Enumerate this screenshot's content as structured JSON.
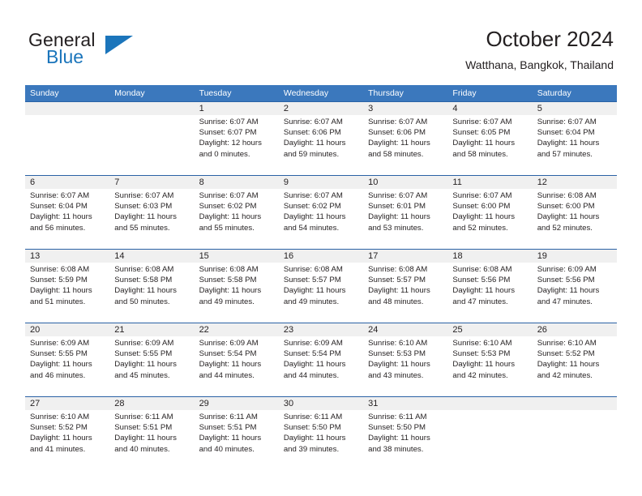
{
  "brand": {
    "name_top": "General",
    "name_bottom": "Blue",
    "logo_icon": "triangle-icon",
    "color_blue": "#1b75bb",
    "color_dark": "#231f20"
  },
  "header": {
    "title": "October 2024",
    "subtitle": "Watthana, Bangkok, Thailand"
  },
  "theme": {
    "header_band": "#3b78bd",
    "week_rule": "#2a62a5",
    "date_strip": "#f0f0f0",
    "text": "#231f20"
  },
  "weekdays": [
    "Sunday",
    "Monday",
    "Tuesday",
    "Wednesday",
    "Thursday",
    "Friday",
    "Saturday"
  ],
  "weeks": [
    {
      "days": [
        {
          "num": "",
          "sunrise": "",
          "sunset": "",
          "daylight1": "",
          "daylight2": ""
        },
        {
          "num": "",
          "sunrise": "",
          "sunset": "",
          "daylight1": "",
          "daylight2": ""
        },
        {
          "num": "1",
          "sunrise": "Sunrise: 6:07 AM",
          "sunset": "Sunset: 6:07 PM",
          "daylight1": "Daylight: 12 hours",
          "daylight2": "and 0 minutes."
        },
        {
          "num": "2",
          "sunrise": "Sunrise: 6:07 AM",
          "sunset": "Sunset: 6:06 PM",
          "daylight1": "Daylight: 11 hours",
          "daylight2": "and 59 minutes."
        },
        {
          "num": "3",
          "sunrise": "Sunrise: 6:07 AM",
          "sunset": "Sunset: 6:06 PM",
          "daylight1": "Daylight: 11 hours",
          "daylight2": "and 58 minutes."
        },
        {
          "num": "4",
          "sunrise": "Sunrise: 6:07 AM",
          "sunset": "Sunset: 6:05 PM",
          "daylight1": "Daylight: 11 hours",
          "daylight2": "and 58 minutes."
        },
        {
          "num": "5",
          "sunrise": "Sunrise: 6:07 AM",
          "sunset": "Sunset: 6:04 PM",
          "daylight1": "Daylight: 11 hours",
          "daylight2": "and 57 minutes."
        }
      ]
    },
    {
      "days": [
        {
          "num": "6",
          "sunrise": "Sunrise: 6:07 AM",
          "sunset": "Sunset: 6:04 PM",
          "daylight1": "Daylight: 11 hours",
          "daylight2": "and 56 minutes."
        },
        {
          "num": "7",
          "sunrise": "Sunrise: 6:07 AM",
          "sunset": "Sunset: 6:03 PM",
          "daylight1": "Daylight: 11 hours",
          "daylight2": "and 55 minutes."
        },
        {
          "num": "8",
          "sunrise": "Sunrise: 6:07 AM",
          "sunset": "Sunset: 6:02 PM",
          "daylight1": "Daylight: 11 hours",
          "daylight2": "and 55 minutes."
        },
        {
          "num": "9",
          "sunrise": "Sunrise: 6:07 AM",
          "sunset": "Sunset: 6:02 PM",
          "daylight1": "Daylight: 11 hours",
          "daylight2": "and 54 minutes."
        },
        {
          "num": "10",
          "sunrise": "Sunrise: 6:07 AM",
          "sunset": "Sunset: 6:01 PM",
          "daylight1": "Daylight: 11 hours",
          "daylight2": "and 53 minutes."
        },
        {
          "num": "11",
          "sunrise": "Sunrise: 6:07 AM",
          "sunset": "Sunset: 6:00 PM",
          "daylight1": "Daylight: 11 hours",
          "daylight2": "and 52 minutes."
        },
        {
          "num": "12",
          "sunrise": "Sunrise: 6:08 AM",
          "sunset": "Sunset: 6:00 PM",
          "daylight1": "Daylight: 11 hours",
          "daylight2": "and 52 minutes."
        }
      ]
    },
    {
      "days": [
        {
          "num": "13",
          "sunrise": "Sunrise: 6:08 AM",
          "sunset": "Sunset: 5:59 PM",
          "daylight1": "Daylight: 11 hours",
          "daylight2": "and 51 minutes."
        },
        {
          "num": "14",
          "sunrise": "Sunrise: 6:08 AM",
          "sunset": "Sunset: 5:58 PM",
          "daylight1": "Daylight: 11 hours",
          "daylight2": "and 50 minutes."
        },
        {
          "num": "15",
          "sunrise": "Sunrise: 6:08 AM",
          "sunset": "Sunset: 5:58 PM",
          "daylight1": "Daylight: 11 hours",
          "daylight2": "and 49 minutes."
        },
        {
          "num": "16",
          "sunrise": "Sunrise: 6:08 AM",
          "sunset": "Sunset: 5:57 PM",
          "daylight1": "Daylight: 11 hours",
          "daylight2": "and 49 minutes."
        },
        {
          "num": "17",
          "sunrise": "Sunrise: 6:08 AM",
          "sunset": "Sunset: 5:57 PM",
          "daylight1": "Daylight: 11 hours",
          "daylight2": "and 48 minutes."
        },
        {
          "num": "18",
          "sunrise": "Sunrise: 6:08 AM",
          "sunset": "Sunset: 5:56 PM",
          "daylight1": "Daylight: 11 hours",
          "daylight2": "and 47 minutes."
        },
        {
          "num": "19",
          "sunrise": "Sunrise: 6:09 AM",
          "sunset": "Sunset: 5:56 PM",
          "daylight1": "Daylight: 11 hours",
          "daylight2": "and 47 minutes."
        }
      ]
    },
    {
      "days": [
        {
          "num": "20",
          "sunrise": "Sunrise: 6:09 AM",
          "sunset": "Sunset: 5:55 PM",
          "daylight1": "Daylight: 11 hours",
          "daylight2": "and 46 minutes."
        },
        {
          "num": "21",
          "sunrise": "Sunrise: 6:09 AM",
          "sunset": "Sunset: 5:55 PM",
          "daylight1": "Daylight: 11 hours",
          "daylight2": "and 45 minutes."
        },
        {
          "num": "22",
          "sunrise": "Sunrise: 6:09 AM",
          "sunset": "Sunset: 5:54 PM",
          "daylight1": "Daylight: 11 hours",
          "daylight2": "and 44 minutes."
        },
        {
          "num": "23",
          "sunrise": "Sunrise: 6:09 AM",
          "sunset": "Sunset: 5:54 PM",
          "daylight1": "Daylight: 11 hours",
          "daylight2": "and 44 minutes."
        },
        {
          "num": "24",
          "sunrise": "Sunrise: 6:10 AM",
          "sunset": "Sunset: 5:53 PM",
          "daylight1": "Daylight: 11 hours",
          "daylight2": "and 43 minutes."
        },
        {
          "num": "25",
          "sunrise": "Sunrise: 6:10 AM",
          "sunset": "Sunset: 5:53 PM",
          "daylight1": "Daylight: 11 hours",
          "daylight2": "and 42 minutes."
        },
        {
          "num": "26",
          "sunrise": "Sunrise: 6:10 AM",
          "sunset": "Sunset: 5:52 PM",
          "daylight1": "Daylight: 11 hours",
          "daylight2": "and 42 minutes."
        }
      ]
    },
    {
      "days": [
        {
          "num": "27",
          "sunrise": "Sunrise: 6:10 AM",
          "sunset": "Sunset: 5:52 PM",
          "daylight1": "Daylight: 11 hours",
          "daylight2": "and 41 minutes."
        },
        {
          "num": "28",
          "sunrise": "Sunrise: 6:11 AM",
          "sunset": "Sunset: 5:51 PM",
          "daylight1": "Daylight: 11 hours",
          "daylight2": "and 40 minutes."
        },
        {
          "num": "29",
          "sunrise": "Sunrise: 6:11 AM",
          "sunset": "Sunset: 5:51 PM",
          "daylight1": "Daylight: 11 hours",
          "daylight2": "and 40 minutes."
        },
        {
          "num": "30",
          "sunrise": "Sunrise: 6:11 AM",
          "sunset": "Sunset: 5:50 PM",
          "daylight1": "Daylight: 11 hours",
          "daylight2": "and 39 minutes."
        },
        {
          "num": "31",
          "sunrise": "Sunrise: 6:11 AM",
          "sunset": "Sunset: 5:50 PM",
          "daylight1": "Daylight: 11 hours",
          "daylight2": "and 38 minutes."
        },
        {
          "num": "",
          "sunrise": "",
          "sunset": "",
          "daylight1": "",
          "daylight2": ""
        },
        {
          "num": "",
          "sunrise": "",
          "sunset": "",
          "daylight1": "",
          "daylight2": ""
        }
      ]
    }
  ]
}
